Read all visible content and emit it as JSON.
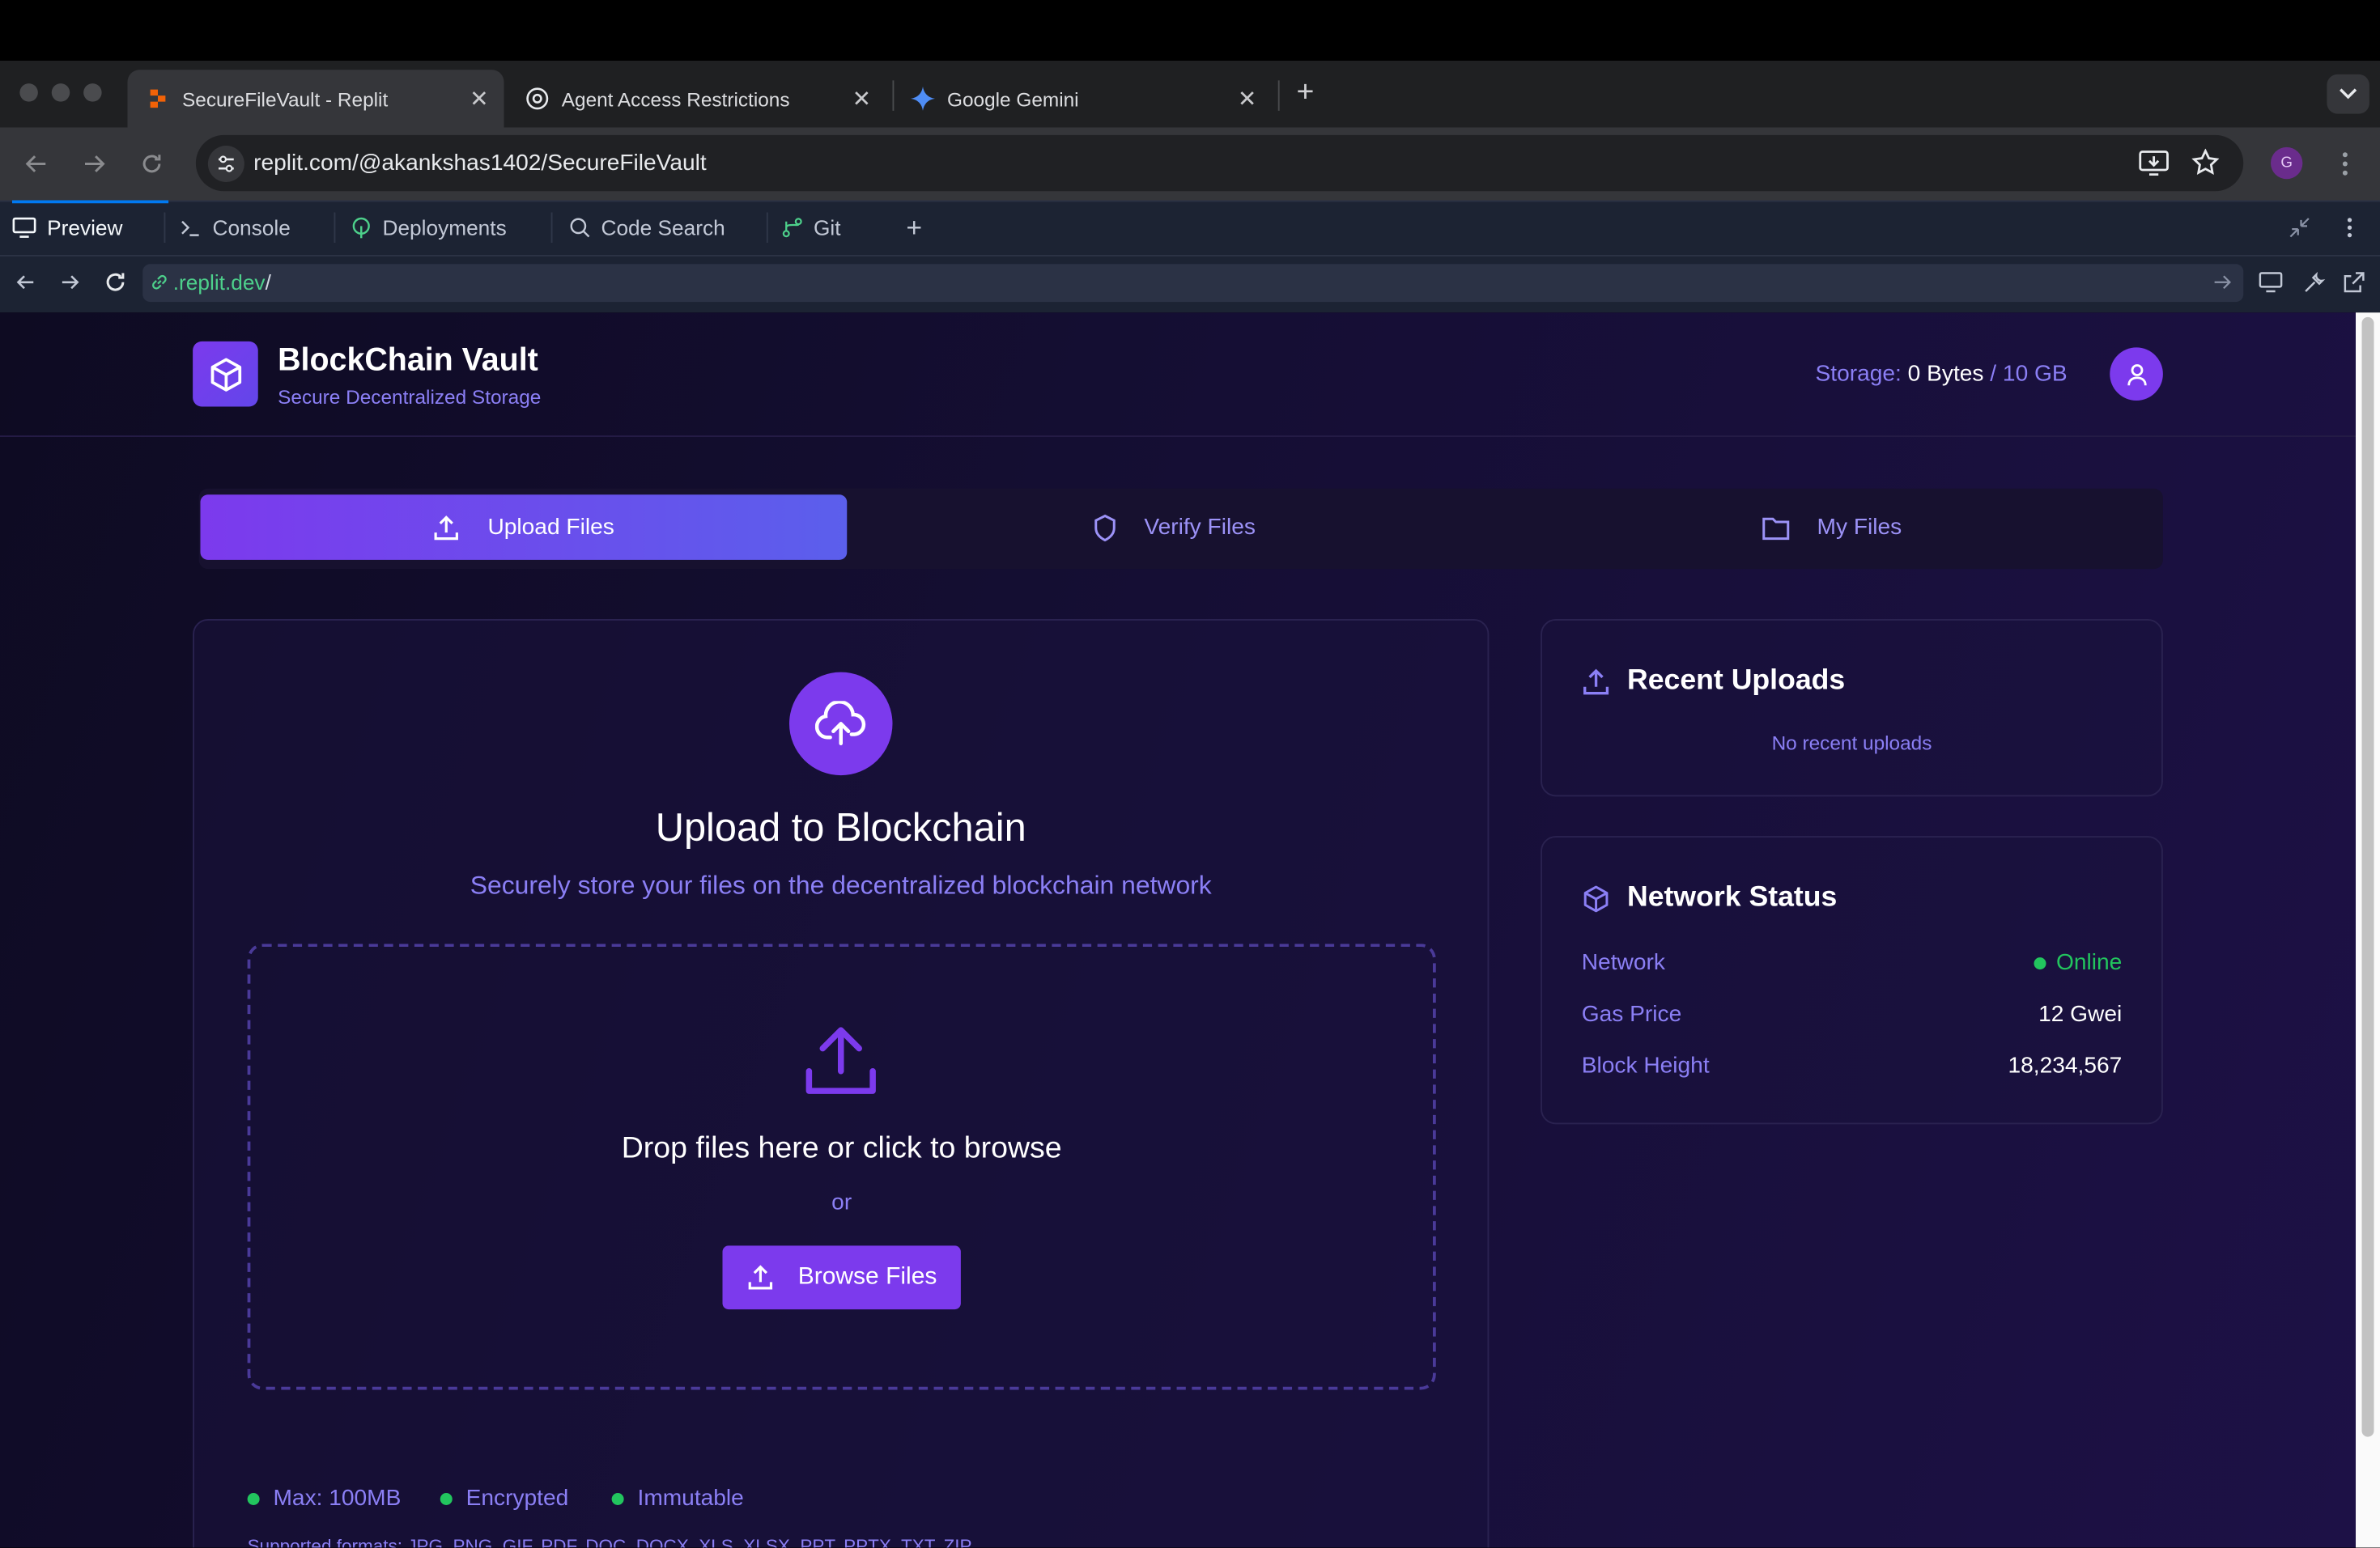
{
  "browser": {
    "tabs": [
      {
        "title": "SecureFileVault - Replit",
        "icon": "replit-icon"
      },
      {
        "title": "Agent Access Restrictions",
        "icon": "openai-icon"
      },
      {
        "title": "Google Gemini",
        "icon": "gemini-icon"
      }
    ],
    "address": "replit.com/@akankshas1402/SecureFileVault",
    "profile_initial": "G"
  },
  "replit": {
    "tabs": [
      "Preview",
      "Console",
      "Deployments",
      "Code Search",
      "Git"
    ],
    "preview_url_host": ".replit.dev",
    "preview_url_path": "/"
  },
  "app": {
    "brand": "BlockChain Vault",
    "tagline": "Secure Decentralized Storage",
    "storage_label": "Storage:",
    "storage_used": "0 Bytes",
    "storage_total": "/ 10 GB",
    "nav": [
      "Upload Files",
      "Verify Files",
      "My Files"
    ],
    "upload": {
      "title": "Upload to Blockchain",
      "subtitle": "Securely store your files on the decentralized blockchain network",
      "drop_text": "Drop files here or click to browse",
      "or": "or",
      "browse": "Browse Files",
      "features": [
        "Max: 100MB",
        "Encrypted",
        "Immutable"
      ],
      "formats": "Supported formats: JPG, PNG, GIF, PDF, DOC, DOCX, XLS, XLSX, PPT, PPTX, TXT, ZIP"
    },
    "recent": {
      "title": "Recent Uploads",
      "empty": "No recent uploads"
    },
    "network": {
      "title": "Network Status",
      "rows": [
        {
          "label": "Network",
          "value": "Online"
        },
        {
          "label": "Gas Price",
          "value": "12 Gwei"
        },
        {
          "label": "Block Height",
          "value": "18,234,567"
        }
      ]
    }
  },
  "colors": {
    "accent": "#7c3aed",
    "online": "#22c55e",
    "muted_text": "#8b7ff5"
  }
}
